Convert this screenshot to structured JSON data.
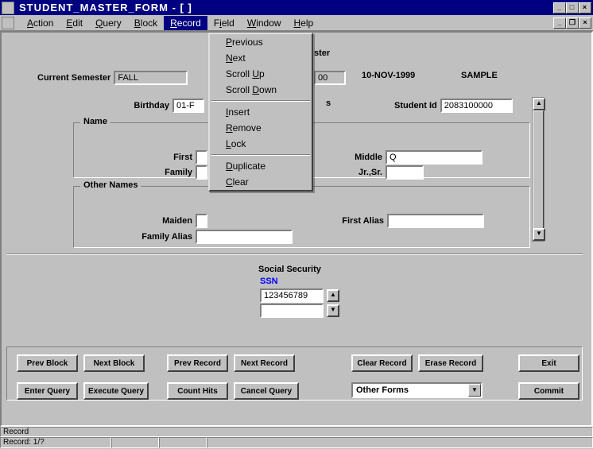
{
  "title": "STUDENT_MASTER_FORM - [ ]",
  "menu": {
    "items": [
      "Action",
      "Edit",
      "Query",
      "Block",
      "Record",
      "Field",
      "Window",
      "Help"
    ],
    "underline_idx": [
      0,
      0,
      0,
      0,
      0,
      1,
      0,
      0
    ],
    "active": "Record"
  },
  "dropdown": {
    "groups": [
      [
        "Previous",
        "Next",
        "Scroll Up",
        "Scroll Down"
      ],
      [
        "Insert",
        "Remove",
        "Lock"
      ],
      [
        "Duplicate",
        "Clear"
      ]
    ],
    "underline_idx": [
      [
        0,
        0,
        7,
        7
      ],
      [
        0,
        0,
        0
      ],
      [
        0,
        0
      ]
    ]
  },
  "header": {
    "current_semester_label": "Current Semester",
    "current_semester_value": "FALL",
    "ster_label": "ster",
    "ster_value": "00",
    "date": "10-NOV-1999",
    "sample": "SAMPLE"
  },
  "fields": {
    "birthday_label": "Birthday",
    "birthday_value": "01-F",
    "s_label": "s",
    "student_id_label": "Student Id",
    "student_id_value": "2083100000"
  },
  "name": {
    "group": "Name",
    "first_label": "First",
    "first_value": "",
    "family_label": "Family",
    "family_value": "",
    "middle_label": "Middle",
    "middle_value": "Q",
    "jrsr_label": "Jr.,Sr.",
    "jrsr_value": ""
  },
  "other": {
    "group": "Other Names",
    "maiden_label": "Maiden",
    "maiden_value": "",
    "family_alias_label": "Family Alias",
    "family_alias_value": "",
    "first_alias_label": "First Alias",
    "first_alias_value": ""
  },
  "ssn": {
    "group": "Social Security",
    "ssn_label": "SSN",
    "ssn_value": "123456789"
  },
  "buttons": {
    "prev_block": "Prev Block",
    "next_block": "Next Block",
    "prev_record": "Prev Record",
    "next_record": "Next Record",
    "clear_record": "Clear Record",
    "erase_record": "Erase Record",
    "exit": "Exit",
    "enter_query": "Enter Query",
    "execute_query": "Execute Query",
    "count_hits": "Count Hits",
    "cancel_query": "Cancel Query",
    "commit": "Commit"
  },
  "other_forms": {
    "label": "Other Forms"
  },
  "status": {
    "line1": "Record",
    "line2": "Record: 1/?"
  }
}
